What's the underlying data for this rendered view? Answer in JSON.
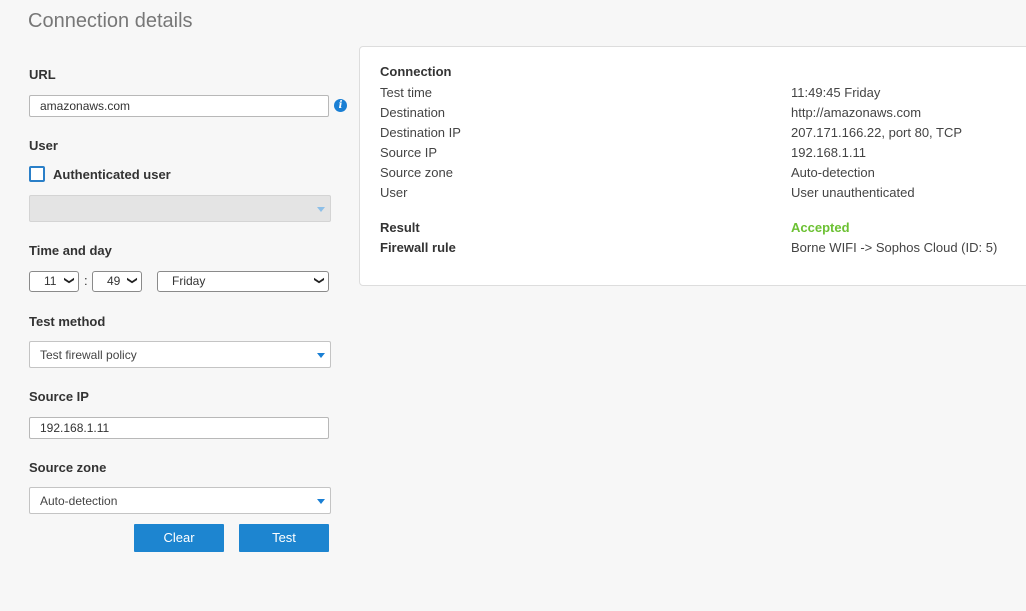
{
  "page": {
    "title": "Connection details"
  },
  "form": {
    "url": {
      "label": "URL",
      "value": "amazonaws.com"
    },
    "user": {
      "label": "User",
      "checkbox_label": "Authenticated user",
      "checked": false,
      "selected": ""
    },
    "time_and_day": {
      "label": "Time and day",
      "hour": "11",
      "minute": "49",
      "separator": ":",
      "day": "Friday"
    },
    "test_method": {
      "label": "Test method",
      "selected": "Test firewall policy"
    },
    "source_ip": {
      "label": "Source IP",
      "value": "192.168.1.11"
    },
    "source_zone": {
      "label": "Source zone",
      "selected": "Auto-detection"
    },
    "buttons": {
      "clear": "Clear",
      "test": "Test"
    }
  },
  "icons": {
    "info": "i",
    "select_chevron": "⌄"
  },
  "colors": {
    "accent": "#1d85d0",
    "accepted": "#6cc133"
  },
  "results": {
    "heading": "Connection",
    "rows": [
      {
        "label": "Test time",
        "value": "11:49:45 Friday"
      },
      {
        "label": "Destination",
        "value": "http://amazonaws.com"
      },
      {
        "label": "Destination IP",
        "value": "207.171.166.22, port 80, TCP"
      },
      {
        "label": "Source IP",
        "value": "192.168.1.11"
      },
      {
        "label": "Source zone",
        "value": "Auto-detection"
      },
      {
        "label": "User",
        "value": "User unauthenticated"
      }
    ],
    "result": {
      "label": "Result",
      "value": "Accepted"
    },
    "firewall_rule": {
      "label": "Firewall rule",
      "value": "Borne WIFI -> Sophos Cloud (ID: 5)"
    }
  }
}
